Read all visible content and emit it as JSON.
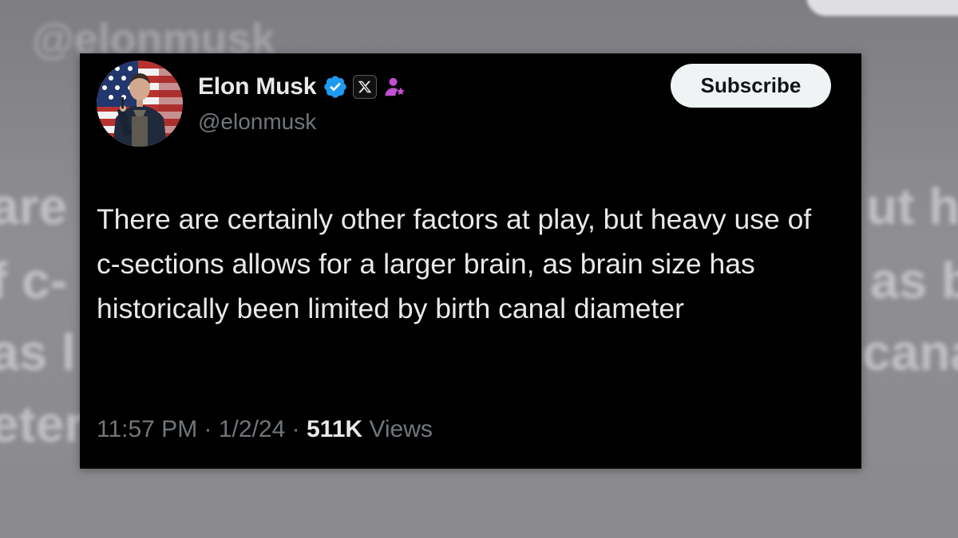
{
  "background": {
    "handle": "@elonmusk",
    "left_fragments": [
      "are",
      "f c-",
      "as l",
      "eter"
    ],
    "right_fragments": [
      "ut h",
      "as b",
      "cana"
    ]
  },
  "tweet": {
    "author_name": "Elon Musk",
    "handle": "@elonmusk",
    "subscribe_label": "Subscribe",
    "text": "There are certainly other factors at play, but heavy use of c-sections allows for a larger brain, as brain size has historically been limited by birth canal diameter",
    "time": "11:57 PM",
    "date": "1/2/24",
    "separator": "·",
    "views_count": "511K",
    "views_label": "Views",
    "icons": {
      "verified": "verified-badge-icon",
      "affiliate": "x-logo-icon",
      "profile": "person-icon"
    },
    "colors": {
      "card_background": "#000000",
      "verified_blue": "#1d9bf0",
      "name_text": "#e7e9ea",
      "secondary_text": "#71767b",
      "subscribe_button": "#eff3f4",
      "person_icon": "#c14fd1"
    }
  }
}
